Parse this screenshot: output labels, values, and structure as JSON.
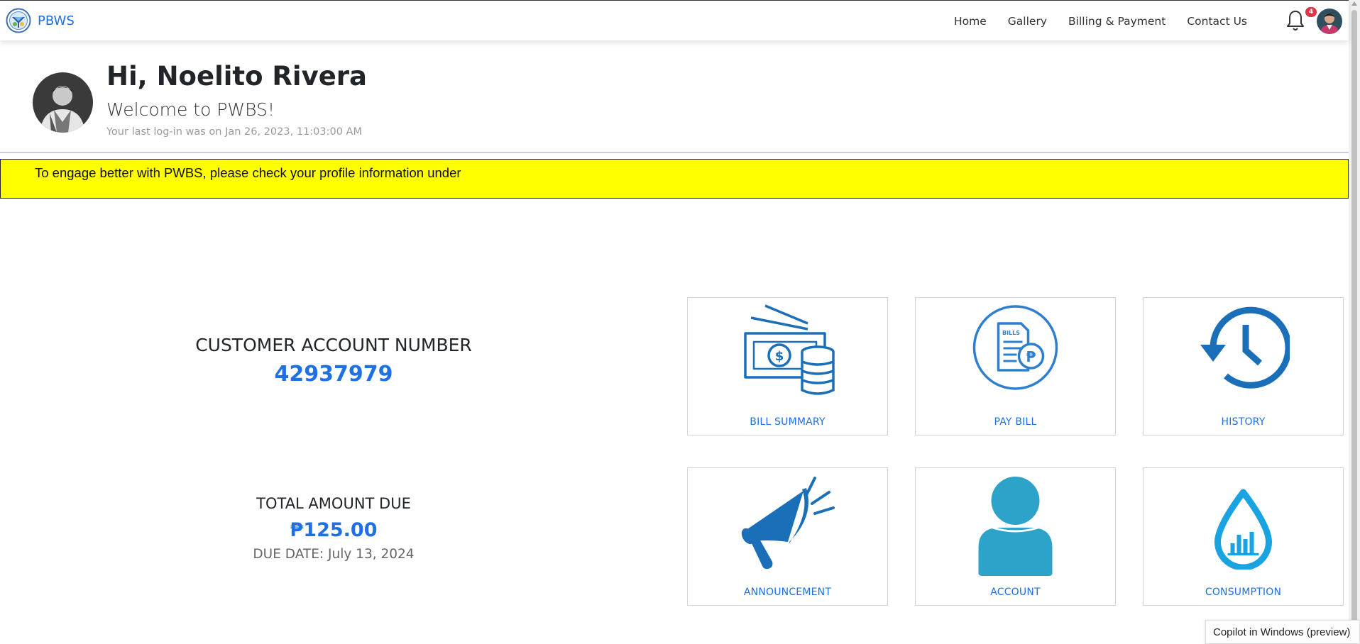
{
  "nav": {
    "brand": "PBWS",
    "links": [
      "Home",
      "Gallery",
      "Billing & Payment",
      "Contact Us"
    ],
    "notification_count": "4"
  },
  "greeting": {
    "title": "Hi, Noelito Rivera",
    "subtitle": "Welcome to PWBS!",
    "last_login": "Your last log-in was on Jan 26, 2023, 11:03:00 AM"
  },
  "banner": {
    "text": "To engage better with PWBS, please check your profile information under"
  },
  "account": {
    "label": "CUSTOMER ACCOUNT NUMBER",
    "number": "42937979"
  },
  "due": {
    "label": "TOTAL AMOUNT DUE",
    "amount": "₱125.00",
    "date": "DUE DATE: July 13, 2024"
  },
  "tiles": [
    {
      "label": "BILL SUMMARY",
      "icon": "cash-coins-icon"
    },
    {
      "label": "PAY BILL",
      "icon": "bill-peso-icon"
    },
    {
      "label": "HISTORY",
      "icon": "history-clock-icon"
    },
    {
      "label": "ANNOUNCEMENT",
      "icon": "megaphone-icon"
    },
    {
      "label": "ACCOUNT",
      "icon": "user-icon"
    },
    {
      "label": "CONSUMPTION",
      "icon": "water-drop-chart-icon"
    }
  ],
  "toast": {
    "text": "Copilot in Windows (preview)"
  },
  "colors": {
    "accent": "#1f6fe5",
    "banner": "#ffff00",
    "icon_blue": "#1b6fb8",
    "account_icon": "#2ea3c9",
    "drop_icon": "#19a3e0"
  }
}
